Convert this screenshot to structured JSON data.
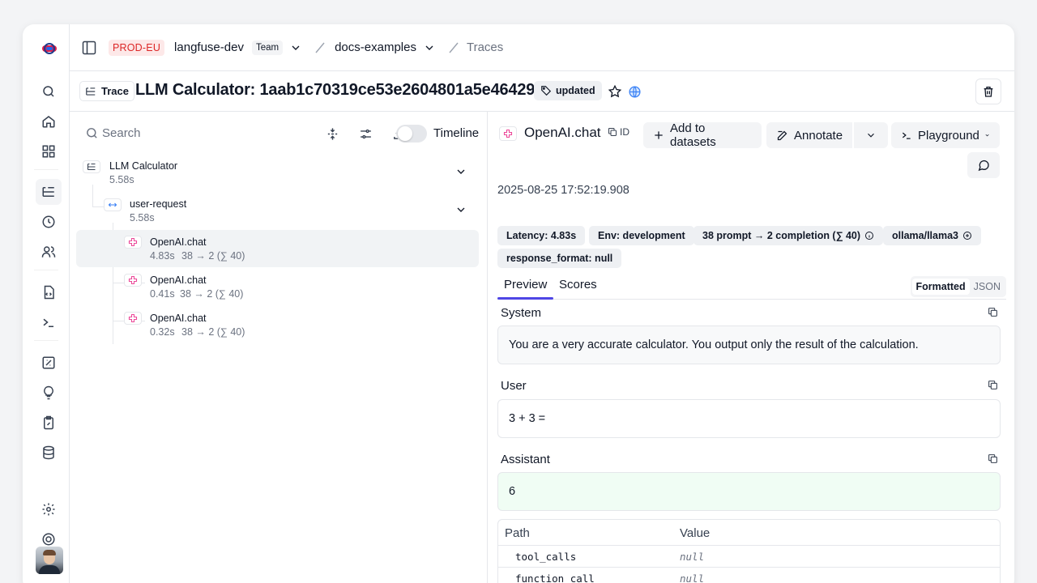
{
  "topbar": {
    "env_badge": "PROD-EU",
    "org": "langfuse-dev",
    "team_badge": "Team",
    "project": "docs-examples",
    "section": "Traces"
  },
  "trace": {
    "type_label": "Trace",
    "title": "LLM Calculator: 1aab1c70319ce53e2604801a5e464293",
    "tag": "updated"
  },
  "left": {
    "search_placeholder": "Search",
    "timeline_label": "Timeline",
    "timeline_on": false,
    "tree": [
      {
        "name": "LLM Calculator",
        "meta": "5.58s"
      },
      {
        "name": "user-request",
        "meta": "5.58s"
      },
      {
        "name": "OpenAI.chat",
        "latency": "4.83s",
        "tokens": "38 → 2 (∑ 40)",
        "selected": true
      },
      {
        "name": "OpenAI.chat",
        "latency": "0.41s",
        "tokens": "38 → 2 (∑ 40)"
      },
      {
        "name": "OpenAI.chat",
        "latency": "0.32s",
        "tokens": "38 → 2 (∑ 40)"
      }
    ]
  },
  "right": {
    "title": "OpenAI.chat",
    "id_label": "ID",
    "buttons": {
      "add_to_datasets": "Add to datasets",
      "annotate": "Annotate",
      "playground": "Playground"
    },
    "timestamp": "2025-08-25 17:52:19.908",
    "chips": {
      "latency": "Latency: 4.83s",
      "env": "Env: development",
      "tokens": "38 prompt → 2 completion (∑ 40)",
      "model": "ollama/llama3",
      "response_format": "response_format: null"
    },
    "tabs": {
      "preview": "Preview",
      "scores": "Scores"
    },
    "format": {
      "formatted": "Formatted",
      "json": "JSON"
    },
    "messages": {
      "system_label": "System",
      "system_text": "You are a very accurate calculator. You output only the result of the calculation.",
      "user_label": "User",
      "user_text": "3 + 3 =",
      "assistant_label": "Assistant",
      "assistant_text": "6"
    },
    "table": {
      "headers": [
        "Path",
        "Value"
      ],
      "rows": [
        {
          "path": "tool_calls",
          "value": "null"
        },
        {
          "path": "function_call",
          "value": "null"
        }
      ]
    }
  }
}
